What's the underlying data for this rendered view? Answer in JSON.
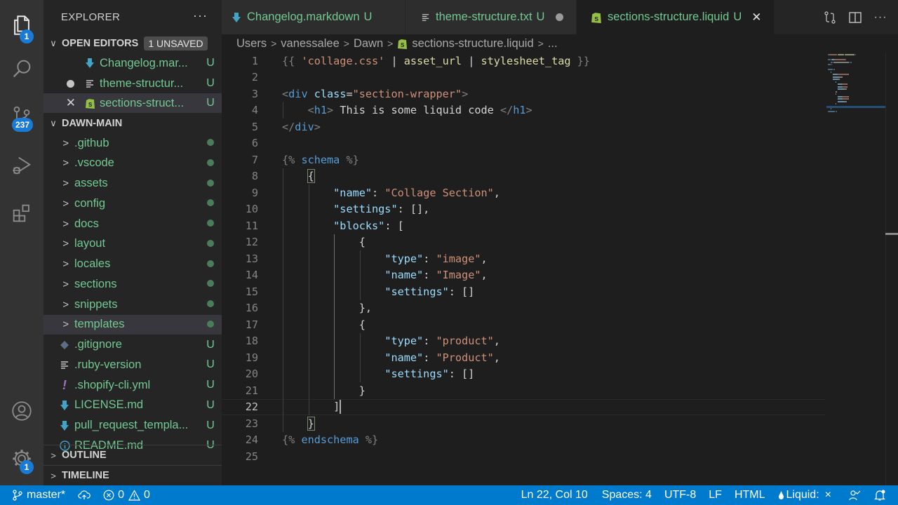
{
  "activity_bar": {
    "items": [
      {
        "name": "explorer",
        "badge": "1"
      },
      {
        "name": "search",
        "badge": null
      },
      {
        "name": "source-control",
        "badge": "237"
      },
      {
        "name": "run-debug",
        "badge": null
      },
      {
        "name": "extensions",
        "badge": null
      }
    ],
    "bottom": [
      {
        "name": "accounts",
        "badge": null
      },
      {
        "name": "manage",
        "badge": "1"
      }
    ]
  },
  "sidebar": {
    "title": "EXPLORER",
    "more": "···",
    "open_editors": {
      "label": "OPEN EDITORS",
      "badge": "1 UNSAVED",
      "items": [
        {
          "name": "Changelog.mar...",
          "status": "U",
          "icon": "markdown-icon",
          "lead": ""
        },
        {
          "name": "theme-structur...",
          "status": "U",
          "icon": "text-file-icon",
          "lead": "unsaved-dot"
        },
        {
          "name": "sections-struct...",
          "status": "U",
          "icon": "shopify-icon",
          "lead": "close"
        }
      ]
    },
    "folder": {
      "label": "DAWN-MAIN",
      "items": [
        {
          "name": ".github",
          "type": "folder"
        },
        {
          "name": ".vscode",
          "type": "folder"
        },
        {
          "name": "assets",
          "type": "folder"
        },
        {
          "name": "config",
          "type": "folder"
        },
        {
          "name": "docs",
          "type": "folder"
        },
        {
          "name": "layout",
          "type": "folder"
        },
        {
          "name": "locales",
          "type": "folder"
        },
        {
          "name": "sections",
          "type": "folder"
        },
        {
          "name": "snippets",
          "type": "folder"
        },
        {
          "name": "templates",
          "type": "folder"
        },
        {
          "name": ".gitignore",
          "type": "file",
          "status": "U",
          "icon": "git-icon"
        },
        {
          "name": ".ruby-version",
          "type": "file",
          "status": "U",
          "icon": "text-file-icon"
        },
        {
          "name": ".shopify-cli.yml",
          "type": "file",
          "status": "U",
          "icon": "yaml-icon"
        },
        {
          "name": "LICENSE.md",
          "type": "file",
          "status": "U",
          "icon": "markdown-icon"
        },
        {
          "name": "pull_request_templa...",
          "type": "file",
          "status": "U",
          "icon": "markdown-icon"
        },
        {
          "name": "README.md",
          "type": "file",
          "status": "U",
          "icon": "info-icon"
        }
      ]
    },
    "outline_label": "OUTLINE",
    "timeline_label": "TIMELINE"
  },
  "tabs": [
    {
      "label": "Changelog.markdown",
      "status": "U",
      "icon": "markdown-icon",
      "active": false
    },
    {
      "label": "theme-structure.txt",
      "status": "U",
      "icon": "text-file-icon",
      "active": false,
      "unsaved": true
    },
    {
      "label": "sections-structure.liquid",
      "status": "U",
      "icon": "shopify-icon",
      "active": true
    }
  ],
  "breadcrumb": [
    "Users",
    "vanessalee",
    "Dawn",
    "sections-structure.liquid",
    "..."
  ],
  "editor": {
    "current_line": 22,
    "lines": [
      [
        [
          "t-punc",
          "{{ "
        ],
        [
          "t-str",
          "'collage.css'"
        ],
        [
          "t-txt",
          " | "
        ],
        [
          "t-fn",
          "asset_url"
        ],
        [
          "t-txt",
          " | "
        ],
        [
          "t-fn",
          "stylesheet_tag"
        ],
        [
          "t-punc",
          " }}"
        ]
      ],
      [],
      [
        [
          "t-punc",
          "<"
        ],
        [
          "t-tag",
          "div"
        ],
        [
          "t-txt",
          " "
        ],
        [
          "t-attr",
          "class"
        ],
        [
          "t-txt",
          "="
        ],
        [
          "t-str",
          "\"section-wrapper\""
        ],
        [
          "t-punc",
          ">"
        ]
      ],
      [
        [
          "t-txt",
          "    "
        ],
        [
          "t-punc",
          "<"
        ],
        [
          "t-tag",
          "h1"
        ],
        [
          "t-punc",
          ">"
        ],
        [
          "t-txt",
          " This is some liquid code "
        ],
        [
          "t-punc",
          "</"
        ],
        [
          "t-tag",
          "h1"
        ],
        [
          "t-punc",
          ">"
        ]
      ],
      [
        [
          "t-punc",
          "</"
        ],
        [
          "t-tag",
          "div"
        ],
        [
          "t-punc",
          ">"
        ]
      ],
      [],
      [
        [
          "t-punc",
          "{% "
        ],
        [
          "t-kw",
          "schema"
        ],
        [
          "t-punc",
          " %}"
        ]
      ],
      [
        [
          "t-txt",
          "    "
        ],
        [
          "t-txt bracket-match",
          "{"
        ]
      ],
      [
        [
          "t-txt",
          "        "
        ],
        [
          "t-key",
          "\"name\""
        ],
        [
          "t-txt",
          ": "
        ],
        [
          "t-str",
          "\"Collage Section\""
        ],
        [
          "t-txt",
          ","
        ]
      ],
      [
        [
          "t-txt",
          "        "
        ],
        [
          "t-key",
          "\"settings\""
        ],
        [
          "t-txt",
          ": [],"
        ]
      ],
      [
        [
          "t-txt",
          "        "
        ],
        [
          "t-key",
          "\"blocks\""
        ],
        [
          "t-txt",
          ": ["
        ]
      ],
      [
        [
          "t-txt",
          "            {"
        ]
      ],
      [
        [
          "t-txt",
          "                "
        ],
        [
          "t-key",
          "\"type\""
        ],
        [
          "t-txt",
          ": "
        ],
        [
          "t-str",
          "\"image\""
        ],
        [
          "t-txt",
          ","
        ]
      ],
      [
        [
          "t-txt",
          "                "
        ],
        [
          "t-key",
          "\"name\""
        ],
        [
          "t-txt",
          ": "
        ],
        [
          "t-str",
          "\"Image\""
        ],
        [
          "t-txt",
          ","
        ]
      ],
      [
        [
          "t-txt",
          "                "
        ],
        [
          "t-key",
          "\"settings\""
        ],
        [
          "t-txt",
          ": []"
        ]
      ],
      [
        [
          "t-txt",
          "            },"
        ]
      ],
      [
        [
          "t-txt",
          "            {"
        ]
      ],
      [
        [
          "t-txt",
          "                "
        ],
        [
          "t-key",
          "\"type\""
        ],
        [
          "t-txt",
          ": "
        ],
        [
          "t-str",
          "\"product\""
        ],
        [
          "t-txt",
          ","
        ]
      ],
      [
        [
          "t-txt",
          "                "
        ],
        [
          "t-key",
          "\"name\""
        ],
        [
          "t-txt",
          ": "
        ],
        [
          "t-str",
          "\"Product\""
        ],
        [
          "t-txt",
          ","
        ]
      ],
      [
        [
          "t-txt",
          "                "
        ],
        [
          "t-key",
          "\"settings\""
        ],
        [
          "t-txt",
          ": []"
        ]
      ],
      [
        [
          "t-txt",
          "            }"
        ]
      ],
      [
        [
          "t-txt",
          "        ]"
        ]
      ],
      [
        [
          "t-txt",
          "    "
        ],
        [
          "t-txt bracket-match",
          "}"
        ]
      ],
      [
        [
          "t-punc",
          "{% "
        ],
        [
          "t-kw",
          "endschema"
        ],
        [
          "t-punc",
          " %}"
        ]
      ],
      []
    ]
  },
  "status_bar": {
    "branch": "master*",
    "errors": "0",
    "warnings": "0",
    "position": "Ln 22, Col 10",
    "spaces": "Spaces: 4",
    "encoding": "UTF-8",
    "eol": "LF",
    "language": "HTML",
    "liquid": "Liquid:",
    "liquid_close": "×"
  },
  "colors": {
    "accent": "#007acc",
    "untracked": "#73c991",
    "badge": "#1a7bd6"
  }
}
